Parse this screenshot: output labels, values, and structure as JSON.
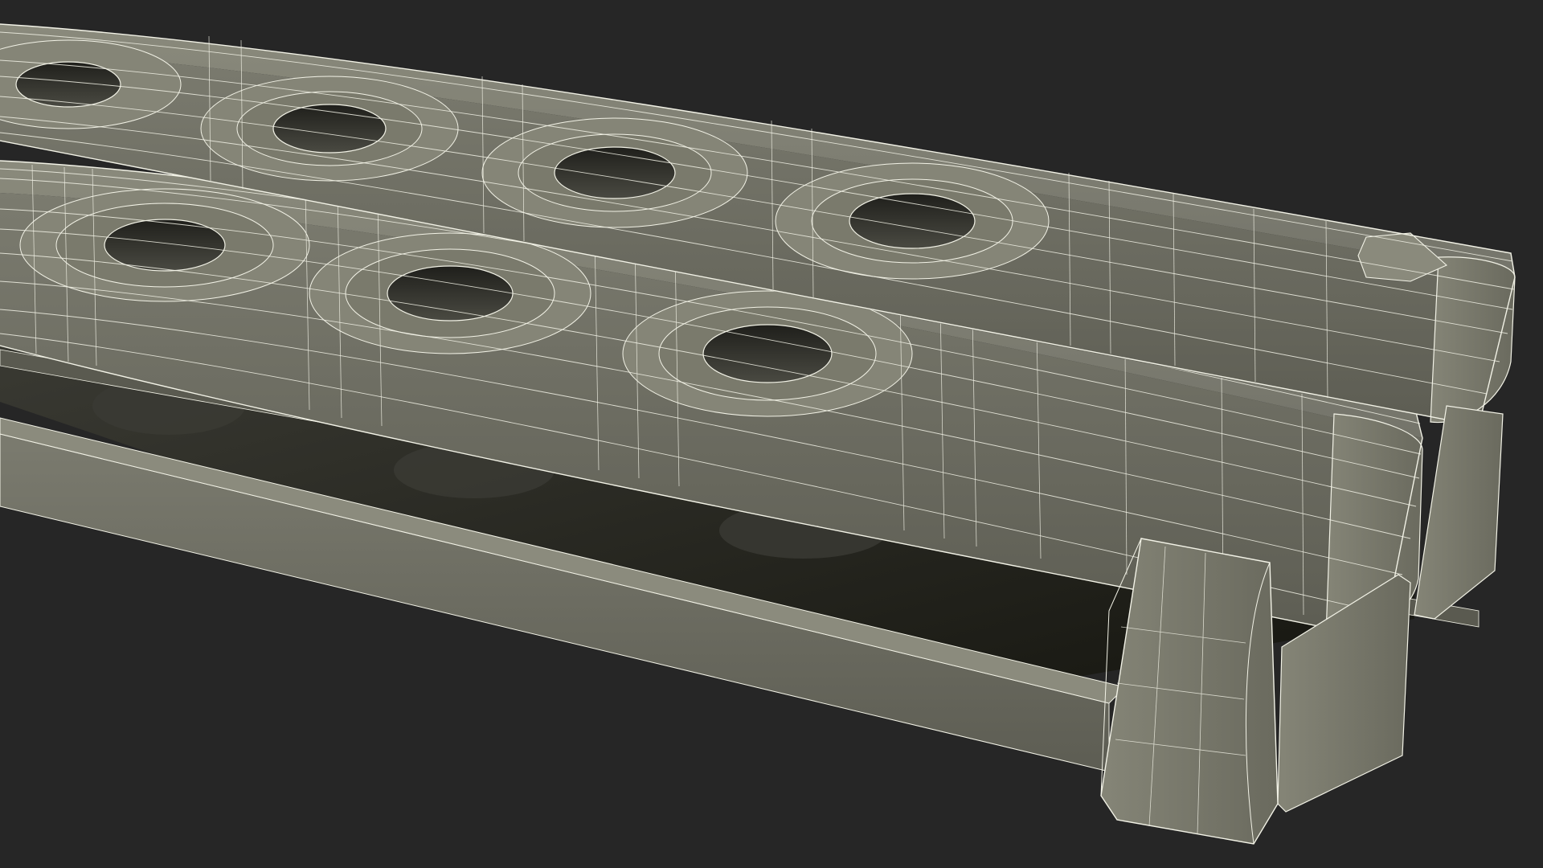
{
  "scene": {
    "background": "#262626",
    "subject": "wireframe-render-butterfly-knife-handle",
    "surface_color": "#7d7d6f",
    "surface_highlight": "#8f8f80",
    "surface_shadow": "#4a4a40",
    "hole_color": "#2c2c26",
    "wire_color": "#f2f2e6",
    "edge_dark": "#1e1e1a"
  }
}
